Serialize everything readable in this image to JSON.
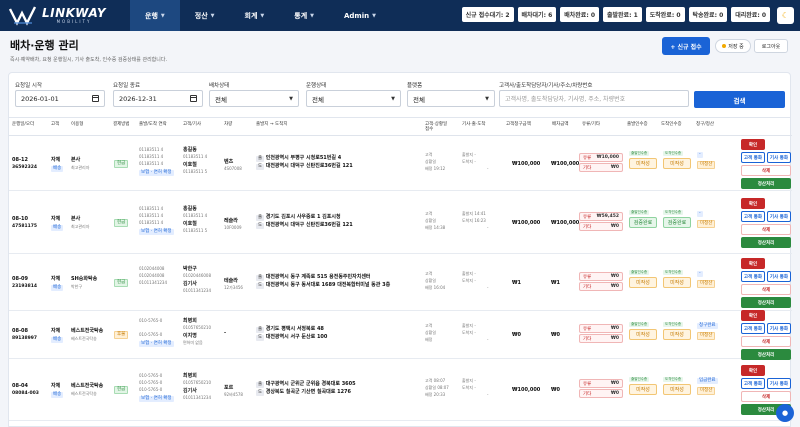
{
  "brand": {
    "name": "LINKWAY",
    "sub": "MOBILITY"
  },
  "nav": [
    {
      "label": "운행"
    },
    {
      "label": "정산"
    },
    {
      "label": "회계"
    },
    {
      "label": "통계"
    },
    {
      "label": "Admin"
    }
  ],
  "badges": [
    "신규 접수대기: 2",
    "배차대기: 6",
    "배차완료: 0",
    "출발완료: 1",
    "도착완료: 0",
    "탁송완료: 0",
    "대리완료: 0"
  ],
  "page": {
    "title": "배차·운행 관리",
    "subtitle": "즉시·예약배차, 요청 운행일시, 기사 출도착, 인수증 검증상태를 관리합니다.",
    "new_btn": "+ 신규 접수",
    "hold_btn": "저장 중",
    "logout_btn": "로그아웃"
  },
  "filters": {
    "start_label": "요청일 시작",
    "start_value": "2026-01-01",
    "end_label": "요청일 종료",
    "end_value": "2026-12-31",
    "dispatch_label": "배차상태",
    "dispatch_value": "전체",
    "run_label": "운행상태",
    "run_value": "전체",
    "platform_label": "플랫폼",
    "platform_value": "전체",
    "search_label": "고객사/출도착담당자/기사/주소/차량번호",
    "search_placeholder": "고객사명, 출도착담당자, 기사명, 주소, 차량번호",
    "search_btn": "검색"
  },
  "columns": [
    "운행일/오더",
    "고객",
    "이용형",
    "결제방법",
    "출발/도착 연락",
    "고객/기사",
    "차량",
    "출발지 → 도착지",
    "고객·상황일\n접수",
    "기사·출·도착",
    "고객청구금액",
    "배차금액",
    "유류/기타",
    "출발인수증",
    "도착인수증",
    "청구/정산",
    ""
  ],
  "rows": [
    {
      "date": "08-12",
      "order": "36592324",
      "cust": "자체",
      "cust_tag": "배송",
      "client": "본사",
      "client_sub": "최고관리자",
      "pay": "현금",
      "tel1": "01183511 4",
      "tel1b": "01183511 4",
      "tel2": "01183511 4",
      "tel_tag": "보험 · 면허 확정",
      "c_name1": "홍길동",
      "c_sub1": "01183511 4",
      "c_name2": "이호철",
      "c_sub2": "01183511 5",
      "car": "벤츠",
      "car_sub": "4S07008",
      "from": "인천광역시 부평구 시청로51번길 4",
      "to": "대전광역시 대덕구 신탄진로36번길 121",
      "t1": "고객",
      "t1v": "",
      "t2": "상황일",
      "t2v": "",
      "t3": "배정",
      "t3v": "19:12",
      "d1": "출발지",
      "d1v": "-",
      "d2": "도착지",
      "d2v": "-",
      "d3": "",
      "d3v": "-",
      "bill": "₩100,000",
      "disp": "₩100,000",
      "fee_label": "유류",
      "fee_val": "₩10,000",
      "etc_label": "기타",
      "etc_val": "₩0",
      "rec1": "미작성",
      "rec2": "미작성",
      "settle": "-",
      "settle2": "미정산",
      "mini1": "출발인수증",
      "mini2": "도착인수증"
    },
    {
      "date": "08-10",
      "order": "47581175",
      "cust": "자체",
      "cust_tag": "배송",
      "client": "본사",
      "client_sub": "최고관리자",
      "pay": "현금",
      "tel1": "01183511 4",
      "tel1b": "01183511 4",
      "tel2": "01183511 4",
      "tel_tag": "보험 · 면허 확정",
      "c_name1": "홍길동",
      "c_sub1": "01183511 4",
      "c_name2": "이호철",
      "c_sub2": "01183511 5",
      "car": "레슬라",
      "car_sub": "10F0009",
      "from": "경기도 김포시 사우중로 1 김포시청",
      "to": "대전광역시 대덕구 신탄진로36번길 121",
      "t1": "고객",
      "t1v": "",
      "t2": "상황일",
      "t2v": "",
      "t3": "배정",
      "t3v": "14:38",
      "d1": "출발지",
      "d1v": "14:41",
      "d2": "도착지",
      "d2v": "16:23",
      "d3": "",
      "d3v": "-",
      "bill": "₩100,000",
      "disp": "₩100,000",
      "fee_label": "유류",
      "fee_val": "₩59,452",
      "etc_label": "기타",
      "etc_val": "₩0",
      "rec1": "검증완료",
      "rec2": "검증완료",
      "settle": "-",
      "settle2": "미정산",
      "mini1": "출발인수증",
      "mini2": "도착인수증"
    },
    {
      "date": "08-09",
      "order": "23193814",
      "cust": "자체",
      "cust_tag": "배송",
      "client": "SH승화탁송",
      "client_sub": "박한구",
      "pay": "현금",
      "tel1": "0102044008",
      "tel1b": "0102044008",
      "tel2": "01011341234",
      "tel_tag": "",
      "c_name1": "박한구",
      "c_sub1": "01020446008",
      "c_name2": "김기사",
      "c_sub2": "01011341234",
      "car": "테슬라",
      "car_sub": "12가3456",
      "from": "대전광역시 동구 계족로 515 용전동주민자치센터",
      "to": "대전광역시 동구 동서대로 1689 대전복합터미널 동관 3층",
      "t1": "고객",
      "t1v": "",
      "t2": "상황일",
      "t2v": "",
      "t3": "배정",
      "t3v": "16:04",
      "d1": "출발지",
      "d1v": "-",
      "d2": "도착지",
      "d2v": "-",
      "d3": "",
      "d3v": "-",
      "bill": "₩1",
      "disp": "₩1",
      "fee_label": "유류",
      "fee_val": "₩0",
      "etc_label": "기타",
      "etc_val": "₩0",
      "rec1": "미작성",
      "rec2": "미작성",
      "settle": "-",
      "settle2": "미정산",
      "mini1": "출발인수증",
      "mini2": "도착인수증"
    },
    {
      "date": "08-08",
      "order": "89138997",
      "cust": "자체",
      "cust_tag": "배송",
      "client": "베스트전국탁송",
      "client_sub": "베스트전국탁송",
      "pay": "후불",
      "tel1": "010-5765-0",
      "tel1b": "",
      "tel2": "010-5765-0",
      "tel_tag": "보험 · 면허 확정",
      "c_name1": "최병희",
      "c_sub1": "01057650210",
      "c_name2": "이지명",
      "c_sub2": "면허미 없음",
      "car": "-",
      "car_sub": "",
      "from": "경기도 평택시 서정북로 48",
      "to": "대전광역시 서구 둔산로 100",
      "t1": "고객",
      "t1v": "",
      "t2": "상황일",
      "t2v": "",
      "t3": "배정",
      "t3v": "",
      "d1": "출발지",
      "d1v": "-",
      "d2": "도착지",
      "d2v": "-",
      "d3": "",
      "d3v": "-",
      "bill": "₩0",
      "disp": "₩0",
      "fee_label": "유류",
      "fee_val": "₩0",
      "etc_label": "기타",
      "etc_val": "₩0",
      "rec1": "미작성",
      "rec2": "미작성",
      "settle": "청구완료",
      "settle2": "미정산",
      "mini1": "출발인수증",
      "mini2": "도착인수증"
    },
    {
      "date": "08-04",
      "order": "08084-003",
      "cust": "자체",
      "cust_tag": "배송",
      "client": "베스트전국탁송",
      "client_sub": "베스트전국탁송",
      "pay": "현금",
      "tel1": "010-5765-0",
      "tel1b": "010-5765-0",
      "tel2": "010-5765-0",
      "tel_tag": "보험 · 면허 확정",
      "c_name1": "최병희",
      "c_sub1": "01057650210",
      "c_name2": "김기사",
      "c_sub2": "01011341234",
      "car": "포르",
      "car_sub": "92바4578",
      "from": "대구광역시 군위군 군위읍 경북대로 3605",
      "to": "경상북도 칠곡군 기산면 칠곡대로 1276",
      "t1": "고객",
      "t1v": "08:07",
      "t2": "상황일",
      "t2v": "08:07",
      "t3": "배정",
      "t3v": "20:33",
      "d1": "출발지",
      "d1v": "-",
      "d2": "도착지",
      "d2v": "-",
      "d3": "",
      "d3v": "-",
      "bill": "₩100,000",
      "disp": "₩0",
      "fee_label": "유류",
      "fee_val": "₩0",
      "etc_label": "기타",
      "etc_val": "₩0",
      "rec1": "미작성",
      "rec2": "미작성",
      "settle": "입금완료",
      "settle2": "미정산",
      "mini1": "출발인수증",
      "mini2": "도착인수증"
    }
  ],
  "actions": {
    "confirm": "확인",
    "cust_call": "고객 통화",
    "driver_call": "기사 통화",
    "delete": "삭제",
    "settle": "정산처리"
  },
  "chat_icon": "chat-icon"
}
